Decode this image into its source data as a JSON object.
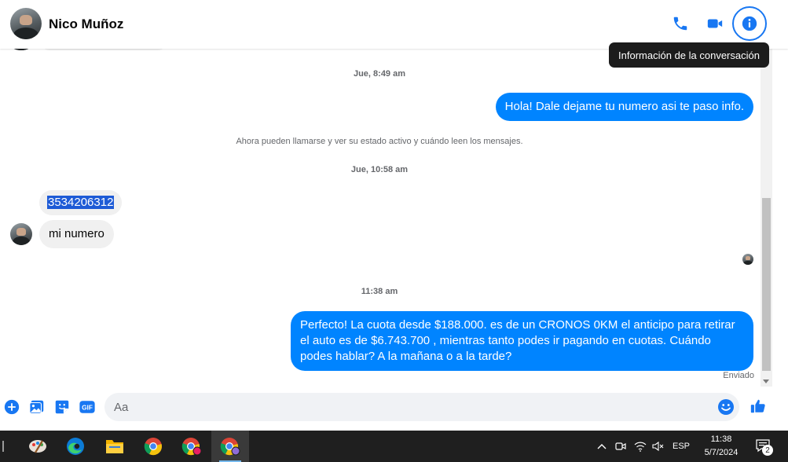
{
  "header": {
    "contact_name": "Nico Muñoz",
    "tooltip": "Información de la conversación"
  },
  "messages": {
    "time_1": "Jue, 8:49 am",
    "out_1": "Hola! Dale dejame tu numero  asi te paso info.",
    "system_notice": "Ahora pueden llamarse y ver su estado activo y cuándo leen los mensajes.",
    "time_2": "Jue, 10:58 am",
    "in_1": "3534206312",
    "in_2": "mi numero",
    "time_3": "11:38 am",
    "out_2": "Perfecto! La cuota desde $188.000. es de un CRONOS 0KM el anticipo para retirar el auto es de $6.743.700 , mientras tanto podes ir pagando en cuotas. Cuándo podes hablar? A la mañana o a la tarde?",
    "status": "Enviado"
  },
  "composer": {
    "placeholder": "Aa"
  },
  "taskbar": {
    "language": "ESP",
    "time": "11:38",
    "date": "5/7/2024",
    "notification_count": "2"
  },
  "colors": {
    "accent": "#1877f2",
    "outgoing_bubble": "#0084ff",
    "incoming_bubble": "#f0f0f0",
    "taskbar": "#1f1f1f"
  }
}
